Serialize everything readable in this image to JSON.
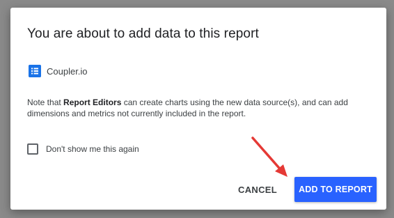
{
  "dialog": {
    "title": "You are about to add data to this report",
    "source_name": "Coupler.io",
    "note_prefix": "Note that ",
    "note_bold": "Report Editors",
    "note_suffix": " can create charts using the new data source(s), and can add dimensions and metrics not currently included in the report.",
    "checkbox_label": "Don't show me this again",
    "checkbox_checked": false,
    "cancel_label": "CANCEL",
    "add_label": "ADD TO REPORT"
  },
  "colors": {
    "primary_button": "#2962ff",
    "source_icon": "#1a73e8",
    "annotation_arrow": "#e53935",
    "backdrop": "#8a8a8a"
  },
  "icons": {
    "source": "list-icon",
    "annotation": "red-arrow-icon"
  }
}
